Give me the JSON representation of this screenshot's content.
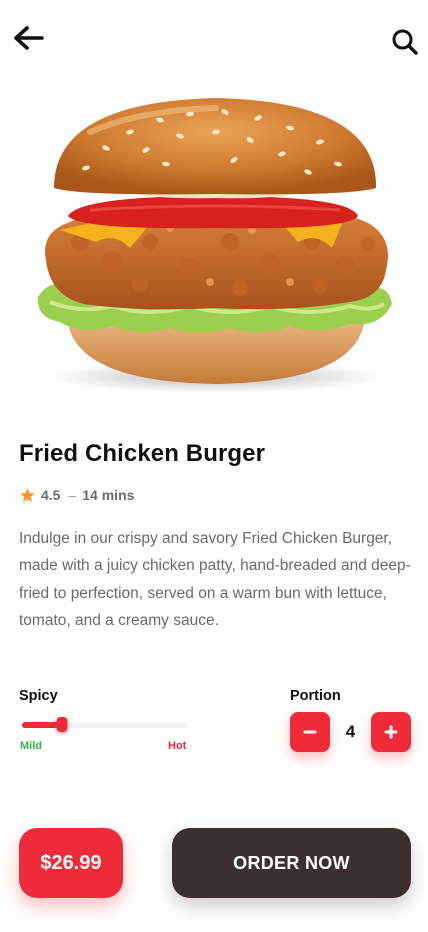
{
  "header": {
    "back_icon": "arrow-left-icon",
    "search_icon": "search-icon"
  },
  "product": {
    "name": "Fried Chicken Burger",
    "image_icon": "burger-image",
    "rating": "4.5",
    "separator": "–",
    "time": "14 mins",
    "description": "Indulge in our crispy and savory Fried Chicken Burger, made with a juicy chicken patty, hand-breaded and deep-fried to perfection, served on a warm bun with lettuce, tomato, and a creamy sauce."
  },
  "spicy": {
    "label": "Spicy",
    "min_label": "Mild",
    "max_label": "Hot",
    "level": 0.24
  },
  "portion": {
    "label": "Portion",
    "value": "4"
  },
  "footer": {
    "price": "$26.99",
    "order_label": "ORDER NOW"
  },
  "colors": {
    "accent": "#EF2A39",
    "dark": "#3C2F2F",
    "mild": "#3AB54A",
    "star": "#FF9633"
  }
}
